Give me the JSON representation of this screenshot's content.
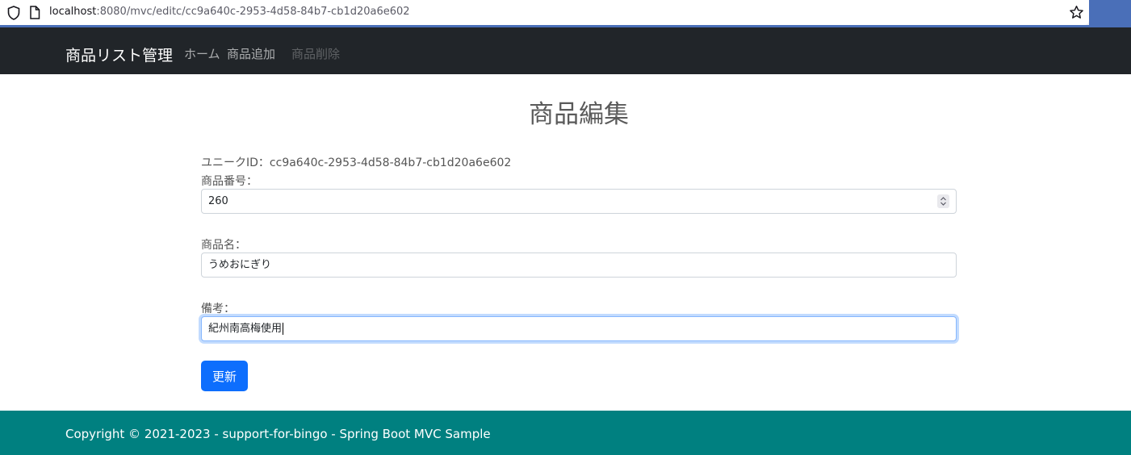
{
  "browser": {
    "url_host": "localhost",
    "url_rest": ":8080/mvc/editc/cc9a640c-2953-4d58-84b7-cb1d20a6e602",
    "icons": [
      "shield-icon",
      "page-icon",
      "star-icon"
    ]
  },
  "navbar": {
    "brand": "商品リスト管理",
    "links": [
      {
        "label": "ホーム",
        "state": "normal"
      },
      {
        "label": "商品追加",
        "state": "normal"
      },
      {
        "label": "商品削除",
        "state": "disabled"
      }
    ]
  },
  "main": {
    "title": "商品編集",
    "unique_id_label": "ユニークID：",
    "unique_id_value": "cc9a640c-2953-4d58-84b7-cb1d20a6e602",
    "fields": [
      {
        "label": "商品番号：",
        "value": "260",
        "type": "number"
      },
      {
        "label": "商品名：",
        "value": "うめおにぎり",
        "type": "text"
      },
      {
        "label": "備考：",
        "value": "紀州南高梅使用",
        "type": "text",
        "focused": true
      }
    ],
    "submit_label": "更新"
  },
  "footer": {
    "text": "Copyright © 2021-2023 - support-for-bingo - Spring Boot MVC Sample"
  },
  "colors": {
    "navbar_bg": "#212529",
    "footer_bg": "#008080",
    "primary": "#0d6efd",
    "browser_accent": "#4a6fb8"
  }
}
